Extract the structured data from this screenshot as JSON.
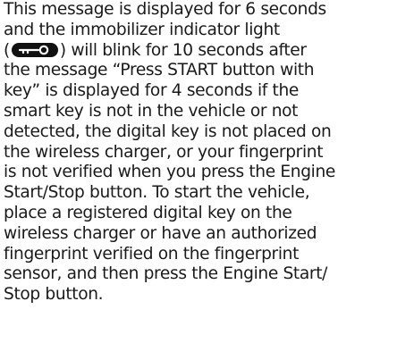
{
  "doc": {
    "lines": [
      "This message is displayed for 6 seconds",
      "and the immobilizer indicator light",
      null,
      "the message “Press START button with",
      "key” is displayed for 4 seconds if the",
      "smart key is not in the vehicle or not",
      "detected, the digital key is not placed on",
      "the wireless charger, or your fingerprint",
      "is not verified when you press the Engine",
      "Start/Stop button. To start the vehicle,",
      "place a registered digital key on the",
      "wireless charger or have an authorized",
      "fingerprint verified on the fingerprint",
      "sensor, and then press the Engine Start/",
      "Stop button."
    ],
    "line3": {
      "open_paren": "(",
      "close_paren_rest": ") will blink for 10 seconds after"
    },
    "icon": "immobilizer-key-icon"
  }
}
